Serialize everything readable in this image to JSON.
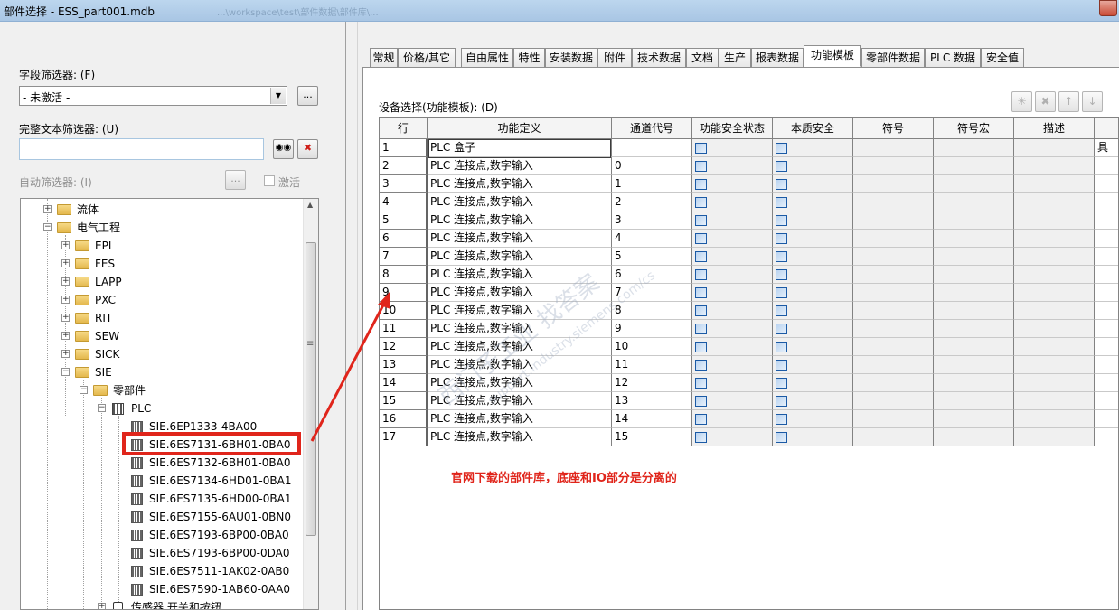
{
  "window": {
    "title": "部件选择 - ESS_part001.mdb",
    "blurred_path": "...\\workspace\\test\\部件数据\\部件库\\..."
  },
  "filters": {
    "field_filter_label": "字段筛选器: (F)",
    "field_filter_value": "- 未激活 -",
    "fulltext_filter_label": "完整文本筛选器: (U)",
    "fulltext_value": "",
    "auto_filter_label": "自动筛选器: (I)",
    "activate_label": "激活",
    "more_button": "..."
  },
  "tree": {
    "items": [
      {
        "label": "流体"
      },
      {
        "label": "电气工程"
      },
      {
        "label": "EPL"
      },
      {
        "label": "FES"
      },
      {
        "label": "LAPP"
      },
      {
        "label": "PXC"
      },
      {
        "label": "RIT"
      },
      {
        "label": "SEW"
      },
      {
        "label": "SICK"
      },
      {
        "label": "SIE"
      },
      {
        "label": "零部件"
      },
      {
        "label": "PLC"
      },
      {
        "label": "SIE.6EP1333-4BA00"
      },
      {
        "label": "SIE.6ES7131-6BH01-0BA0"
      },
      {
        "label": "SIE.6ES7132-6BH01-0BA0"
      },
      {
        "label": "SIE.6ES7134-6HD01-0BA1"
      },
      {
        "label": "SIE.6ES7135-6HD00-0BA1"
      },
      {
        "label": "SIE.6ES7155-6AU01-0BN0"
      },
      {
        "label": "SIE.6ES7193-6BP00-0BA0"
      },
      {
        "label": "SIE.6ES7193-6BP00-0DA0"
      },
      {
        "label": "SIE.6ES7511-1AK02-0AB0"
      },
      {
        "label": "SIE.6ES7590-1AB60-0AA0"
      },
      {
        "label": "传感器 开关和按钮"
      }
    ]
  },
  "tabs": [
    {
      "label": "常规"
    },
    {
      "label": "价格/其它"
    },
    {
      "label": "自由属性"
    },
    {
      "label": "特性"
    },
    {
      "label": "安装数据"
    },
    {
      "label": "附件"
    },
    {
      "label": "技术数据"
    },
    {
      "label": "文档"
    },
    {
      "label": "生产"
    },
    {
      "label": "报表数据"
    },
    {
      "label": "功能模板"
    },
    {
      "label": "零部件数据"
    },
    {
      "label": "PLC 数据"
    },
    {
      "label": "安全值"
    }
  ],
  "panel": {
    "device_select_label": "设备选择(功能模板): (D)",
    "toolbar": {
      "new": "✳",
      "delete": "✖",
      "up": "↑",
      "down": "↓"
    }
  },
  "grid": {
    "headers": [
      "行",
      "功能定义",
      "通道代号",
      "功能安全状态",
      "本质安全",
      "符号",
      "符号宏",
      "描述",
      ""
    ],
    "rows": [
      {
        "row": "1",
        "func": "PLC 盒子",
        "channel": "",
        "extra": "具"
      },
      {
        "row": "2",
        "func": "PLC 连接点,数字输入",
        "channel": "0"
      },
      {
        "row": "3",
        "func": "PLC 连接点,数字输入",
        "channel": "1"
      },
      {
        "row": "4",
        "func": "PLC 连接点,数字输入",
        "channel": "2"
      },
      {
        "row": "5",
        "func": "PLC 连接点,数字输入",
        "channel": "3"
      },
      {
        "row": "6",
        "func": "PLC 连接点,数字输入",
        "channel": "4"
      },
      {
        "row": "7",
        "func": "PLC 连接点,数字输入",
        "channel": "5"
      },
      {
        "row": "8",
        "func": "PLC 连接点,数字输入",
        "channel": "6"
      },
      {
        "row": "9",
        "func": "PLC 连接点,数字输入",
        "channel": "7"
      },
      {
        "row": "10",
        "func": "PLC 连接点,数字输入",
        "channel": "8"
      },
      {
        "row": "11",
        "func": "PLC 连接点,数字输入",
        "channel": "9"
      },
      {
        "row": "12",
        "func": "PLC 连接点,数字输入",
        "channel": "10"
      },
      {
        "row": "13",
        "func": "PLC 连接点,数字输入",
        "channel": "11"
      },
      {
        "row": "14",
        "func": "PLC 连接点,数字输入",
        "channel": "12"
      },
      {
        "row": "15",
        "func": "PLC 连接点,数字输入",
        "channel": "13"
      },
      {
        "row": "16",
        "func": "PLC 连接点,数字输入",
        "channel": "14"
      },
      {
        "row": "17",
        "func": "PLC 连接点,数字输入",
        "channel": "15"
      }
    ]
  },
  "annotation": {
    "text": "官网下载的部件库，底座和IO部分是分离的",
    "color": "#e0251b"
  },
  "watermark": {
    "line1": "西门子工业  找答案",
    "line2": "support.industry.siemens.com/cs"
  },
  "colors": {
    "accent_red": "#e0251b",
    "checkbox_blue": "#1b5aa5"
  }
}
